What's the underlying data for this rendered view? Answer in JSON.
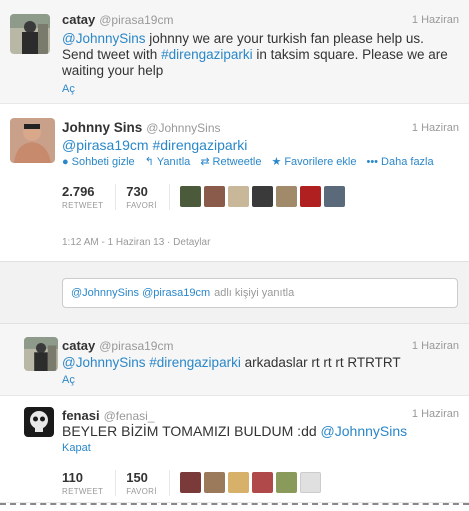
{
  "tweets": [
    {
      "name": "catay",
      "handle": "@pirasa19cm",
      "date": "1 Haziran",
      "mention": "@JohnnySins",
      "text1": " johnny we are your turkish fan please help us. Send tweet with ",
      "hashtag": "#direngaziparki",
      "text2": " in taksim square. Please we are waiting your help",
      "open_label": "Aç"
    },
    {
      "name": "Johnny Sins",
      "handle": "@JohnnySins",
      "date": "1 Haziran",
      "mention": "@pirasa19cm",
      "hashtag": "#direngaziparki",
      "actions": {
        "hide": "Sohbeti gizle",
        "reply": "Yanıtla",
        "retweet": "Retweetle",
        "favorite": "Favorilere ekle",
        "more": "Daha fazla"
      },
      "retweets": "2.796",
      "retweets_label": "RETWEET",
      "favorites": "730",
      "favorites_label": "FAVORİ",
      "meta": "1:12 AM - 1 Haziran 13 · Detaylar"
    },
    {
      "name": "catay",
      "handle": "@pirasa19cm",
      "date": "1 Haziran",
      "mention": "@JohnnySins",
      "hashtag": "#direngaziparki",
      "text": " arkadaslar rt rt rt RTRTRT",
      "open_label": "Aç"
    },
    {
      "name": "fenasi",
      "handle": "@fenasi_",
      "date": "1 Haziran",
      "text": "BEYLER BİZİM TOMAMIZI BULDUM :dd ",
      "mention": "@JohnnySins",
      "close_label": "Kapat",
      "retweets": "110",
      "retweets_label": "RETWEET",
      "favorites": "150",
      "favorites_label": "FAVORİ"
    }
  ],
  "reply": {
    "prefill": "@JohnnySins @pirasa19cm",
    "placeholder": "adlı kişiyi yanıtla"
  },
  "colors": {
    "link": "#2a87c8",
    "muted": "#999999"
  }
}
